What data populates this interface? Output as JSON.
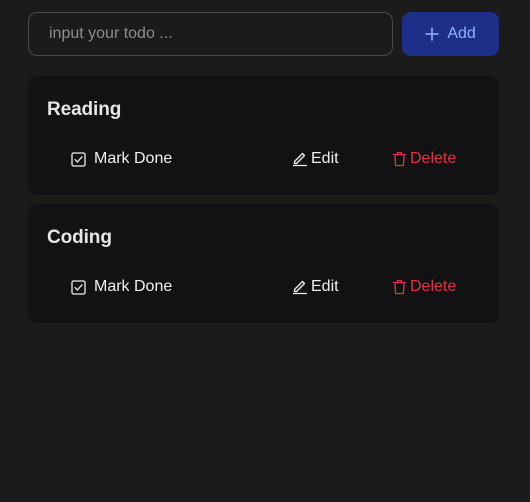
{
  "new_todo": {
    "placeholder": "input your todo ...",
    "value": "",
    "add_label": "Add",
    "add_icon": "plus-icon"
  },
  "todos": [
    {
      "title": "Reading",
      "mark_done_label": "Mark Done",
      "mark_done_icon": "checkbox-icon",
      "edit_label": "Edit",
      "edit_icon": "pencil-icon",
      "delete_label": "Delete",
      "delete_icon": "trash-icon"
    },
    {
      "title": "Coding",
      "mark_done_label": "Mark Done",
      "mark_done_icon": "checkbox-icon",
      "edit_label": "Edit",
      "edit_icon": "pencil-icon",
      "delete_label": "Delete",
      "delete_icon": "trash-icon"
    }
  ],
  "colors": {
    "background": "#1b1b1c",
    "card": "#121214",
    "primary_button": "#1e2f8a",
    "primary_text": "#8fb0ff",
    "delete": "#e5323c"
  }
}
